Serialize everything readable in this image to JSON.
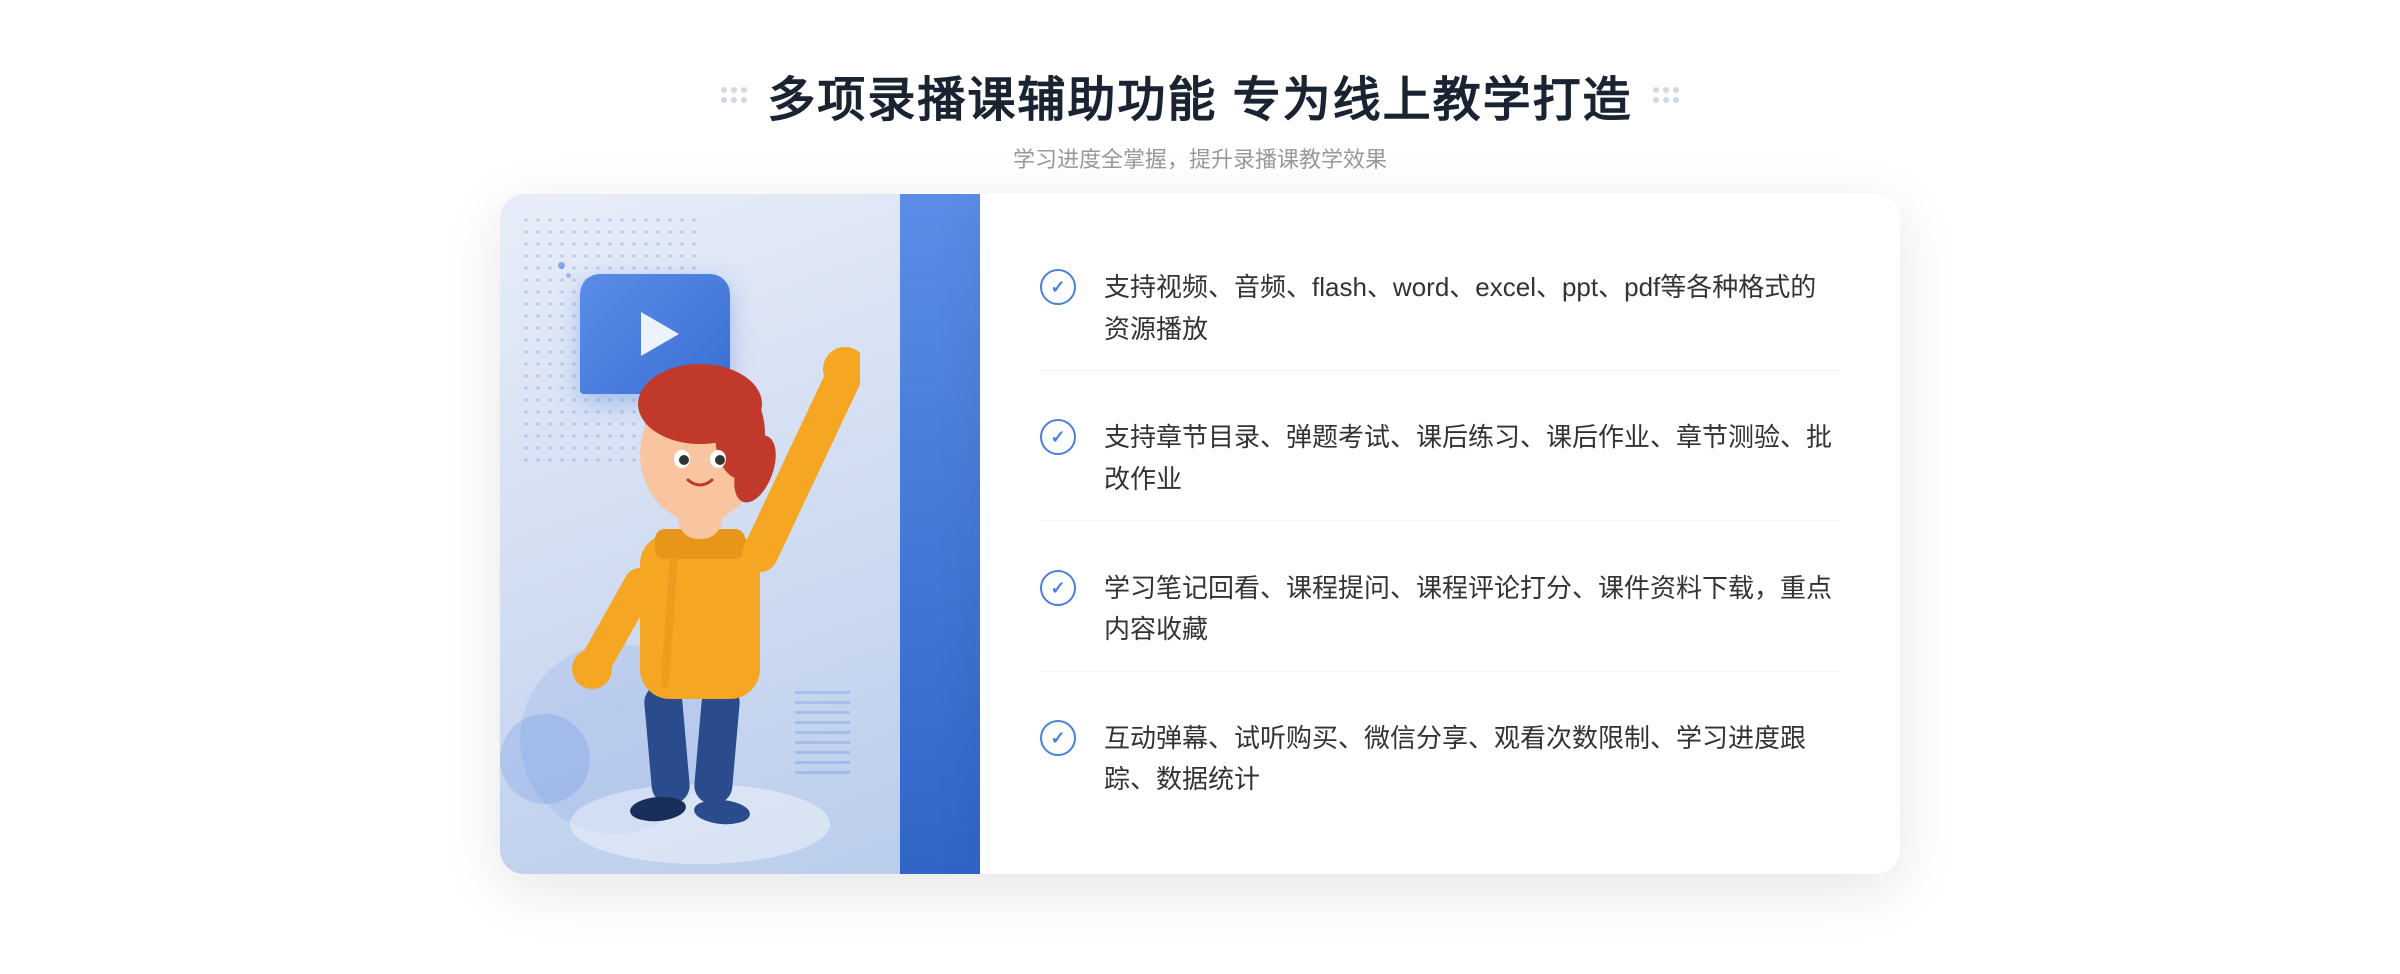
{
  "page": {
    "background": "#ffffff"
  },
  "header": {
    "title": "多项录播课辅助功能 专为线上教学打造",
    "subtitle": "学习进度全掌握，提升录播课教学效果"
  },
  "decorators": {
    "left_dots": "⁞⁞",
    "right_dots": "⁞⁞"
  },
  "features": [
    {
      "id": 1,
      "text": "支持视频、音频、flash、word、excel、ppt、pdf等各种格式的资源播放"
    },
    {
      "id": 2,
      "text": "支持章节目录、弹题考试、课后练习、课后作业、章节测验、批改作业"
    },
    {
      "id": 3,
      "text": "学习笔记回看、课程提问、课程评论打分、课件资料下载，重点内容收藏"
    },
    {
      "id": 4,
      "text": "互动弹幕、试听购买、微信分享、观看次数限制、学习进度跟踪、数据统计"
    }
  ],
  "colors": {
    "primary_blue": "#4a7fe0",
    "dark_blue": "#2d5fc4",
    "light_bg": "#e8edf8",
    "text_dark": "#1a2332",
    "text_gray": "#999999",
    "text_feature": "#333333",
    "accent": "#5b8ce8"
  },
  "chevron": {
    "symbol": "«"
  }
}
